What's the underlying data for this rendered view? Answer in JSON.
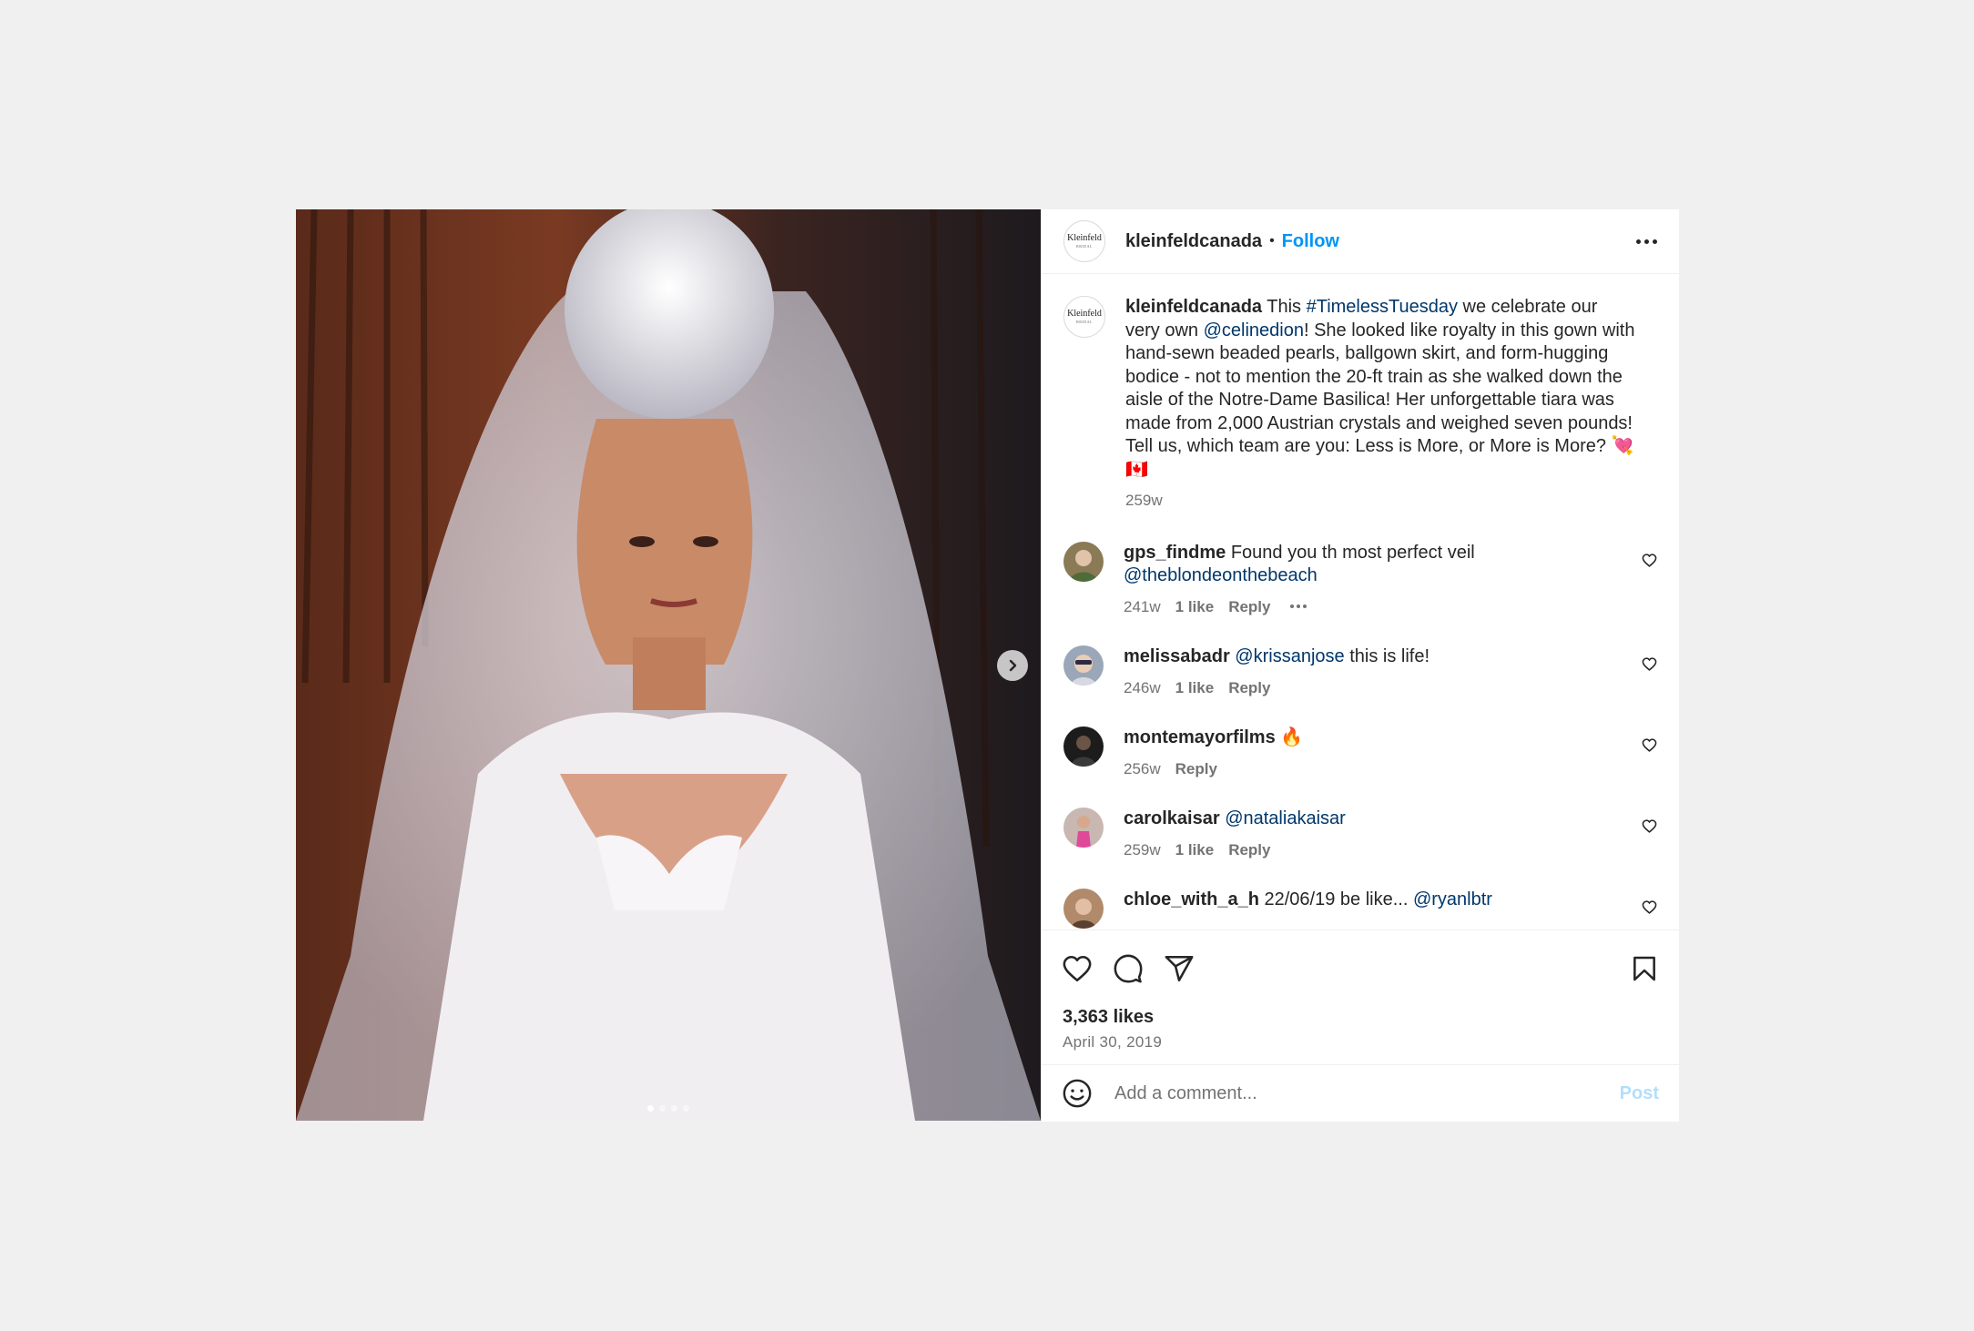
{
  "post": {
    "username": "kleinfeldcanada",
    "follow_label": "Follow",
    "separator": "•",
    "avatar_logo": "Kleinfeld",
    "avatar_logo_sub": "BRIDAL",
    "caption": {
      "username": "kleinfeldcanada",
      "t1": "This ",
      "hashtag": "#TimelessTuesday",
      "t2": " we celebrate our very own ",
      "mention": "@celinedion",
      "t3": "! She looked like royalty in this gown with hand-sewn beaded pearls, ballgown skirt, and form-hugging bodice - not to mention the 20-ft train as she walked down the aisle of the Notre-Dame Basilica! Her unforgettable tiara was made from 2,000 Austrian crystals and weighed seven pounds! Tell us, which team are you: Less is More, or More is More? 💘🇨🇦",
      "time": "259w"
    },
    "comments": [
      {
        "username": "gps_findme",
        "text": "Found you th most perfect veil ",
        "mention": "@theblondeonthebeach",
        "text_after": "",
        "time": "241w",
        "likes": "1 like",
        "reply": "Reply",
        "avatar_color": "#8a7a55"
      },
      {
        "username": "melissabadr",
        "text": "",
        "mention": "@krissanjose",
        "text_after": " this is life!",
        "time": "246w",
        "likes": "1 like",
        "reply": "Reply",
        "avatar_color": "#9aa7b8"
      },
      {
        "username": "montemayorfilms",
        "text": "🔥",
        "mention": "",
        "text_after": "",
        "time": "256w",
        "likes": "",
        "reply": "Reply",
        "avatar_color": "#1c1c1c"
      },
      {
        "username": "carolkaisar",
        "text": "",
        "mention": "@nataliakaisar",
        "text_after": "",
        "time": "259w",
        "likes": "1 like",
        "reply": "Reply",
        "avatar_color": "#c9b7b2"
      },
      {
        "username": "chloe_with_a_h",
        "text": "22/06/19 be like... ",
        "mention": "@ryanlbtr",
        "text_after": "",
        "time": "",
        "likes": "",
        "reply": "",
        "avatar_color": "#b08a6a"
      }
    ],
    "likes_count": "3,363 likes",
    "date": "April 30, 2019",
    "comment_placeholder": "Add a comment...",
    "post_label": "Post",
    "media_dots": 4
  },
  "colors": {
    "accent": "#0095f6",
    "link": "#00376b",
    "muted": "#737373",
    "text": "#262626",
    "background": "#f0f0f0"
  },
  "icons": [
    "chevron-right-icon",
    "more-icon",
    "heart-icon",
    "comment-icon",
    "share-icon",
    "bookmark-icon",
    "emoji-icon"
  ]
}
